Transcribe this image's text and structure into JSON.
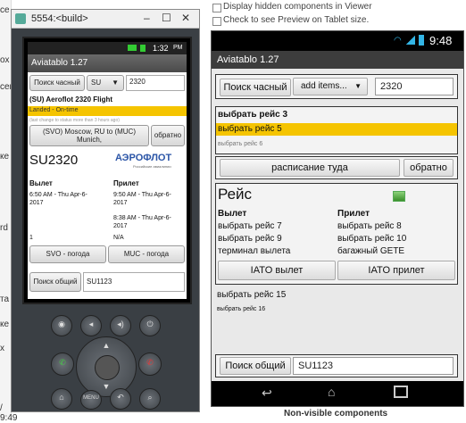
{
  "left_sliver": [
    "се",
    "ox",
    "cer",
    "ке",
    "rd",
    "та",
    "ке",
    "x",
    "/ 9:49"
  ],
  "emulator": {
    "title": "5554:<build>",
    "controls": [
      "–",
      "☐",
      "✕"
    ],
    "status_time": "1:32",
    "status_ampm": "PM",
    "app_title": "Aviatablo 1.27",
    "search_hourly_label": "Поиск часный",
    "airline_code": "SU",
    "flight_number": "2320",
    "flight_title": "(SU) Aeroflot 2320 Flight",
    "status_line": "Landed - On-time",
    "change_note": "(last change to status more than 3 hours ago)",
    "route_label": "(SVO) Moscow, RU to (MUC) Munich,",
    "back_label": "обратно",
    "flight_code": "SU2320",
    "logo_text": "АЭРОФЛОТ",
    "logo_sub": "Российские авиалинии",
    "departure_header": "Вылет",
    "arrival_header": "Прилет",
    "departure_time": "6:50 AM - Thu Apr-6-2017",
    "arrival_time_1": "9:50 AM - Thu Apr-6-2017",
    "arrival_time_2": "8:38 AM - Thu Apr-6-2017",
    "terminal_dep": "1",
    "terminal_arr": "N/A",
    "svo_weather": "SVO - погода",
    "muc_weather": "MUC - погода",
    "search_general_label": "Поиск общий",
    "general_query": "SU1123"
  },
  "designer": {
    "checkbox_hidden": "Display hidden components in Viewer",
    "checkbox_tablet": "Check to see Preview on Tablet size.",
    "status_time": "9:48",
    "app_title": "Aviatablo 1.27",
    "search_hourly_label": "Поиск часный",
    "add_items_label": "add items...",
    "flight_number": "2320",
    "label_flight_3": "выбрать рейс 3",
    "label_flight_5": "выбрать рейс 5",
    "label_flight_6": "выбрать рейс 6",
    "schedule_label": "расписание туда",
    "back_label": "обратно",
    "flight_heading": "Рейс",
    "departure_header": "Вылет",
    "arrival_header": "Прилет",
    "label_flight_7": "выбрать рейс 7",
    "label_flight_8": "выбрать рейс 8",
    "label_flight_9": "выбрать рейс 9",
    "label_flight_10": "выбрать рейс 10",
    "terminal_label": "терминал вылета",
    "baggage_label": "багажный GETE",
    "iato_dep": "IATO вылет",
    "iato_arr": "IATO прилет",
    "label_flight_15": "выбрать рейс 15",
    "label_flight_16": "выбрать рейс 16",
    "search_general_label": "Поиск общий",
    "general_query": "SU1123"
  },
  "nonvisible_label": "Non-visible components",
  "colors": {
    "highlight": "#f5c400",
    "android_blue": "#33b5e5"
  }
}
